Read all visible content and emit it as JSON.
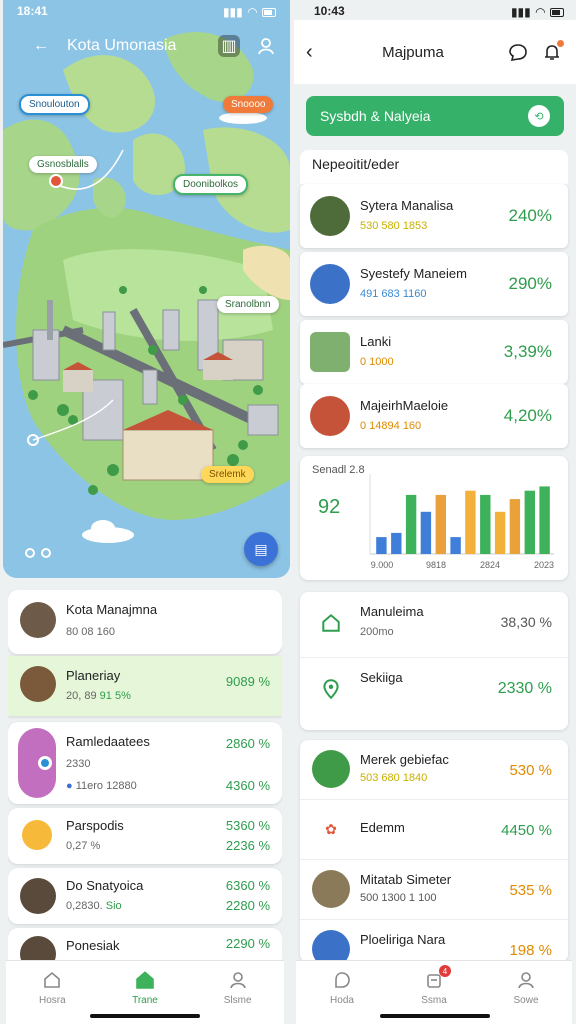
{
  "colors": {
    "accent_green": "#35b16a",
    "text_green": "#2e9d4d",
    "orange": "#f0902a",
    "sea": "#8cc4e6"
  },
  "left_phone": {
    "status": {
      "time": "18:41"
    },
    "header": {
      "title": "Kota Umonasia",
      "back_icon": "arrow-left-icon",
      "book_icon": "book-icon",
      "profile_icon": "user-icon"
    },
    "map": {
      "pills": [
        "Snoulouton",
        "Snoooo",
        "Gsnosblalls",
        "Doonibolkos",
        "Sranolbnn",
        "Srelemk"
      ]
    },
    "list": [
      {
        "name": "Kota Manajmna",
        "sub": "80 08 160"
      },
      {
        "name": "Planeriay",
        "sub": "20, 89",
        "sub_accent": "91 5%",
        "value": "9089 %"
      },
      {
        "name": "Ramledaatees",
        "sub": "2330",
        "sub2": "11ero 12880",
        "value": "2860 %",
        "value2": "4360 %"
      },
      {
        "name": "Parspodis",
        "sub": "0,27 %",
        "value": "5360 %",
        "value2": "2236 %"
      },
      {
        "name": "Do Snatyoica",
        "sub": "0,2830.",
        "sub_accent": "Sio",
        "value": "6360 %",
        "value2": "2280 %"
      },
      {
        "name": "Ponesiak",
        "value": "2290 %"
      }
    ],
    "nav": [
      {
        "label": "Hosra",
        "icon": "home-icon"
      },
      {
        "label": "Trane",
        "icon": "home-icon"
      },
      {
        "label": "Slsme",
        "icon": "user-icon"
      }
    ]
  },
  "right_phone": {
    "status": {
      "time": "10:43"
    },
    "header": {
      "title": "Majpuma",
      "back_icon": "chevron-left-icon",
      "chat_icon": "chat-icon",
      "bell_icon": "bell-icon"
    },
    "banner": {
      "label": "Sysbdh & Nalyeia"
    },
    "section_title": "Nepeoitit/eder",
    "items": [
      {
        "name": "Sytera Manalisa",
        "sub": "530 580 1853",
        "value": "240%",
        "sub_color": "#c9b000"
      },
      {
        "name": "Syestefy Maneiem",
        "sub": "491 683 1160",
        "value": "290%",
        "sub_color": "#3b8bd4"
      },
      {
        "name": "Lanki",
        "sub": "0 1000",
        "value": "3,39%",
        "sub_color": "#e08a00"
      },
      {
        "name": "MajeirhMaeloie",
        "sub": "0 14894 160",
        "value": "4,20%",
        "sub_color": "#e08a00"
      }
    ],
    "chart_data": {
      "type": "bar",
      "title": "Senadl 2.8",
      "big_value": "92",
      "x_tick_labels": [
        "9.000",
        "9818",
        "2824",
        "2023"
      ],
      "series": [
        {
          "color": "#3f7fd9",
          "values": [
            4,
            5,
            2,
            0,
            0,
            0,
            0,
            0,
            0,
            0,
            0,
            0
          ]
        },
        {
          "color": "#3db25a",
          "values": [
            0,
            0,
            0,
            14,
            0,
            0,
            0,
            0,
            0,
            0,
            14,
            16
          ]
        },
        {
          "color": "#f3b13a",
          "values": [
            0,
            0,
            0,
            0,
            0,
            0,
            0,
            0,
            15,
            10,
            15,
            0
          ]
        }
      ],
      "bars": [
        {
          "color": "#3f7fd9",
          "value": 4
        },
        {
          "color": "#3f7fd9",
          "value": 5
        },
        {
          "color": "#3db25a",
          "value": 14
        },
        {
          "color": "#3f7fd9",
          "value": 10
        },
        {
          "color": "#e9a13c",
          "value": 14
        },
        {
          "color": "#3f7fd9",
          "value": 4
        },
        {
          "color": "#f3b13a",
          "value": 15
        },
        {
          "color": "#3db25a",
          "value": 14
        },
        {
          "color": "#f3b13a",
          "value": 10
        },
        {
          "color": "#e9a13c",
          "value": 13
        },
        {
          "color": "#3db25a",
          "value": 15
        },
        {
          "color": "#3db25a",
          "value": 16
        }
      ],
      "ylim": [
        0,
        18
      ]
    },
    "info": [
      {
        "name": "Manuleima",
        "sub": "200mo",
        "value": "38,30 %",
        "icon": "home-icon"
      },
      {
        "name": "Sekiiga",
        "sub": "",
        "value": "2330 %",
        "icon": "location-pin-icon"
      }
    ],
    "list2": [
      {
        "name": "Merek gebiefac",
        "sub": "503 680 1840",
        "value": "530 %",
        "sub_color": "#c9b000",
        "value_color": "#e08a00"
      },
      {
        "name": "Edemm",
        "sub": "",
        "value": "4450 %",
        "value_color": "#2e9d4d"
      },
      {
        "name": "Mitatab Simeter",
        "sub": "500 1300 1 100",
        "value": "535 %",
        "sub_color": "#555",
        "value_color": "#e08a00"
      },
      {
        "name": "Ploeliriga Nara",
        "sub": "",
        "value": "198 %",
        "value_color": "#e08a00"
      }
    ],
    "nav": [
      {
        "label": "Hoda",
        "icon": "home-icon"
      },
      {
        "label": "Ssma",
        "icon": "bell-icon",
        "badge": "4"
      },
      {
        "label": "Sowe",
        "icon": "user-icon"
      }
    ]
  }
}
